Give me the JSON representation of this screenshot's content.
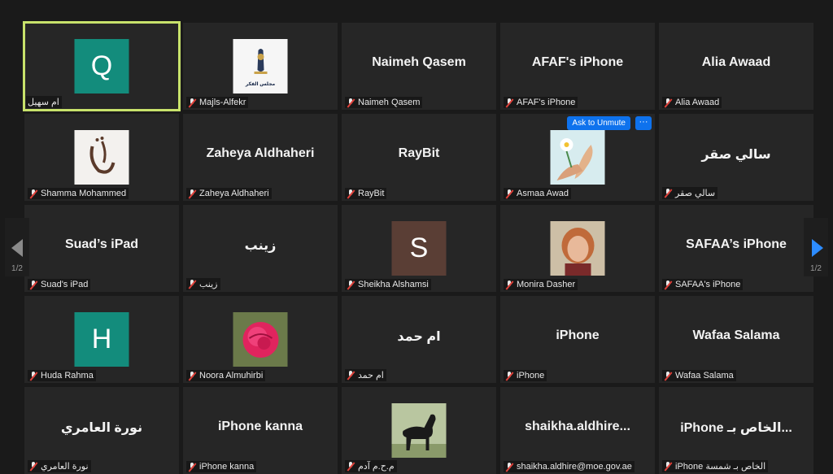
{
  "colors": {
    "background": "#1a1a1a",
    "tile": "#262626",
    "active_border": "#c8e26b",
    "teal_avatar": "#138c7c",
    "brown_avatar": "#5a3e35",
    "accent_blue": "#0e72ed",
    "muted_red": "#e0413a"
  },
  "pager": {
    "left_page": "1/2",
    "right_page": "1/2"
  },
  "tile_actions": {
    "ask_to_unmute": "Ask to Unmute",
    "more": "···"
  },
  "participants": [
    {
      "label": "ام سهيل",
      "avatar_text": "Q",
      "avatar_type": "teal",
      "muted": false
    },
    {
      "label": "Majls-Alfekr",
      "avatar_type": "logo",
      "avatar_text": "مجلس الفكر",
      "muted": true
    },
    {
      "label": "Naimeh Qasem",
      "display_name": "Naimeh Qasem",
      "muted": true
    },
    {
      "label": "AFAF's iPhone",
      "display_name": "AFAF's iPhone",
      "muted": true
    },
    {
      "label": "Alia Awaad",
      "display_name": "Alia Awaad",
      "muted": true
    },
    {
      "label": "Shamma Mohammed",
      "avatar_type": "calligraphy",
      "muted": true
    },
    {
      "label": "Zaheya Aldhaheri",
      "display_name": "Zaheya Aldhaheri",
      "muted": true
    },
    {
      "label": "RayBit",
      "display_name": "RayBit",
      "muted": true
    },
    {
      "label": "Asmaa Awad",
      "avatar_type": "hands-flower",
      "muted": true
    },
    {
      "label": "سالي صقر",
      "display_name": "سالي صقر",
      "muted": true
    },
    {
      "label": "Suad's iPad",
      "display_name": "Suad’s iPad",
      "muted": true
    },
    {
      "label": "زينب",
      "display_name": "زينب",
      "muted": true
    },
    {
      "label": "Sheikha Alshamsi",
      "avatar_text": "S",
      "avatar_type": "brown",
      "muted": true
    },
    {
      "label": "Monira Dasher",
      "avatar_type": "photo-woman",
      "muted": true
    },
    {
      "label": "SAFAA's iPhone",
      "display_name": "SAFAA’s iPhone",
      "muted": true
    },
    {
      "label": "Huda Rahma",
      "avatar_text": "H",
      "avatar_type": "teal",
      "muted": true
    },
    {
      "label": "Noora Almuhirbi",
      "avatar_type": "photo-rose",
      "muted": true
    },
    {
      "label": "ام حمد",
      "display_name": "ام حمد",
      "muted": true
    },
    {
      "label": "iPhone",
      "display_name": "iPhone",
      "muted": true
    },
    {
      "label": "Wafaa Salama",
      "display_name": "Wafaa Salama",
      "muted": true
    },
    {
      "label": "نورة العامري",
      "display_name": "نورة العامري",
      "muted": true
    },
    {
      "label": "iPhone kanna",
      "display_name": "iPhone kanna",
      "muted": true
    },
    {
      "label": "م.ح.م آدم",
      "avatar_type": "photo-horse",
      "muted": true
    },
    {
      "label": "shaikha.aldhire@moe.gov.ae",
      "display_name": "shaikha.aldhire...",
      "muted": true
    },
    {
      "label": "iPhone الخاص بـ شمسة",
      "display_name": "iPhone الخاص بـ...",
      "muted": true
    }
  ]
}
